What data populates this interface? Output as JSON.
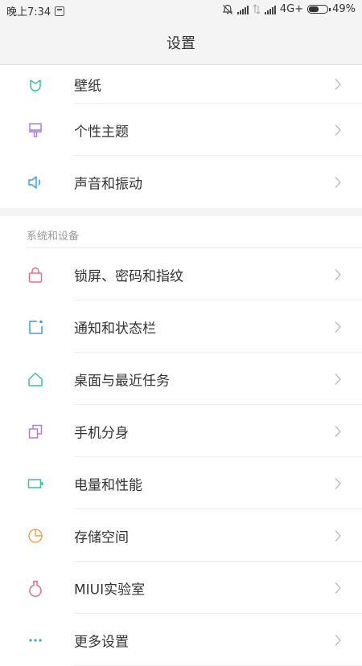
{
  "status_bar": {
    "time": "晚上7:34",
    "network": "4G+",
    "battery": "49%",
    "battery_level": 0.49
  },
  "header": {
    "title": "设置"
  },
  "group1": [
    {
      "label": "壁纸",
      "icon": "wallpaper-icon",
      "color": "#3dbfa0"
    },
    {
      "label": "个性主题",
      "icon": "theme-brush-icon",
      "color": "#b07ee0"
    },
    {
      "label": "声音和振动",
      "icon": "speaker-icon",
      "color": "#3b9fe0"
    }
  ],
  "section": {
    "title": "系统和设备"
  },
  "group2": [
    {
      "label": "锁屏、密码和指纹",
      "icon": "lock-icon",
      "color": "#e86a86"
    },
    {
      "label": "通知和状态栏",
      "icon": "notification-icon",
      "color": "#3b9fe0"
    },
    {
      "label": "桌面与最近任务",
      "icon": "home-icon",
      "color": "#3dbfa0"
    },
    {
      "label": "手机分身",
      "icon": "dual-space-icon",
      "color": "#b07ee0"
    },
    {
      "label": "电量和性能",
      "icon": "battery-icon",
      "color": "#3dbfa0"
    },
    {
      "label": "存储空间",
      "icon": "storage-pie-icon",
      "color": "#f0a050"
    },
    {
      "label": "MIUI实验室",
      "icon": "lab-flask-icon",
      "color": "#e86a86"
    },
    {
      "label": "更多设置",
      "icon": "more-settings-icon",
      "color": "#3b9fe0"
    }
  ]
}
